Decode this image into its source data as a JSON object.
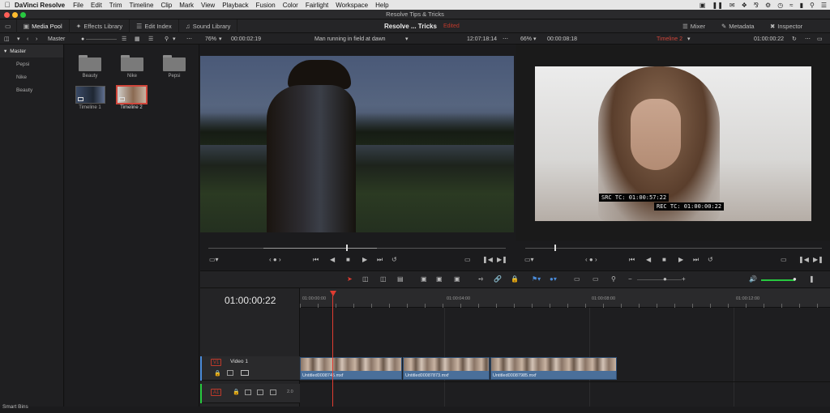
{
  "menubar": {
    "app_name": "DaVinci Resolve",
    "items": [
      "File",
      "Edit",
      "Trim",
      "Timeline",
      "Clip",
      "Mark",
      "View",
      "Playback",
      "Fusion",
      "Color",
      "Fairlight",
      "Workspace",
      "Help"
    ]
  },
  "window": {
    "title": "Resolve Tips & Tricks"
  },
  "toolbar": {
    "media_pool": "Media Pool",
    "effects_library": "Effects Library",
    "edit_index": "Edit Index",
    "sound_library": "Sound Library",
    "project_name": "Resolve ... Tricks",
    "edited_label": "Edited",
    "mixer": "Mixer",
    "metadata": "Metadata",
    "inspector": "Inspector"
  },
  "viewbar": {
    "master_label": "Master",
    "source_zoom": "76%",
    "source_duration": "00:00:02:19",
    "clip_name": "Man running in field at dawn",
    "source_tc": "12:07:18:14",
    "program_zoom": "66%",
    "program_duration": "00:00:08:18",
    "timeline_name": "Timeline 2",
    "program_tc": "01:00:00:22"
  },
  "sidebar": {
    "master": "Master",
    "items": [
      "Pepsi",
      "Nike",
      "Beauty"
    ],
    "smart_bins": "Smart Bins"
  },
  "bins": {
    "folders": [
      "Beauty",
      "Nike",
      "Pepsi"
    ],
    "timelines": [
      "Timeline 1",
      "Timeline 2"
    ]
  },
  "program": {
    "src_tc": "SRC TC: 01:00:57:22",
    "rec_tc": "REC TC: 01:00:00:22"
  },
  "timeline": {
    "current_tc": "01:00:00:22",
    "ruler_ticks": [
      "01:00:00:00",
      "01:00:04:00",
      "01:00:08:00",
      "01:00:12:00"
    ],
    "video_track_badge": "V1",
    "video_track_name": "Video 1",
    "audio_track_badge": "A1",
    "audio_level": "2.0",
    "clips": [
      "Untitled0008745.mxf",
      "Untitled00087873.mxf",
      "Untitled00087985.mxf"
    ]
  },
  "colors": {
    "accent_red": "#c0392b",
    "clip_blue": "#4a6f9a",
    "playhead": "#e03c31"
  }
}
